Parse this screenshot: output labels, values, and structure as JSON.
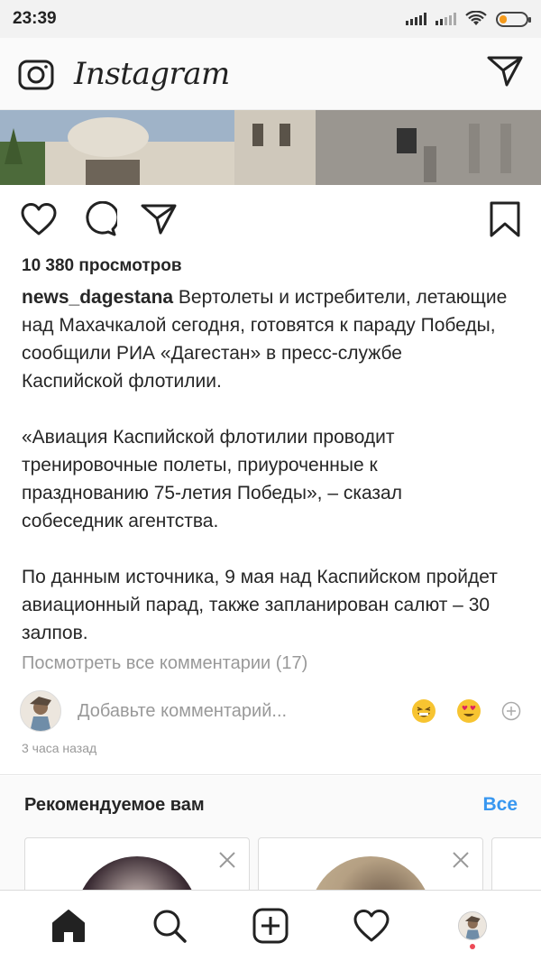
{
  "status_bar": {
    "time": "23:39"
  },
  "header": {
    "logo": "Instagram",
    "camera_icon": "camera-icon",
    "direct_icon": "direct-send-icon"
  },
  "post": {
    "views": "10 380 просмотров",
    "username": "news_dagestana",
    "caption_p1": " Вертолеты и истребители, летающие над Махачкалой сегодня, готовятся к параду Победы, сообщили РИА «Дагестан» в пресс-службе Каспийской флотилии.",
    "caption_p2": "«Авиация Каспийской флотилии проводит тренировочные полеты, приуроченные к празднованию 75-летия Победы», – сказал собеседник агентства.",
    "caption_p3": "По данным источника, 9 мая над Каспийском пройдет авиационный парад, также запланирован салют – 30 залпов.",
    "view_comments": "Посмотреть все комментарии (17)",
    "comment_placeholder": "Добавьте комментарий...",
    "time_ago": "3 часа назад"
  },
  "suggestions": {
    "title": "Рекомендуемое вам",
    "see_all": "Все"
  },
  "colors": {
    "accent": "#3897f0",
    "notification": "#ed4956",
    "text": "#262626",
    "muted": "#999999"
  },
  "nav": [
    "home-icon",
    "search-icon",
    "add-post-icon",
    "activity-heart-icon",
    "profile-avatar"
  ]
}
